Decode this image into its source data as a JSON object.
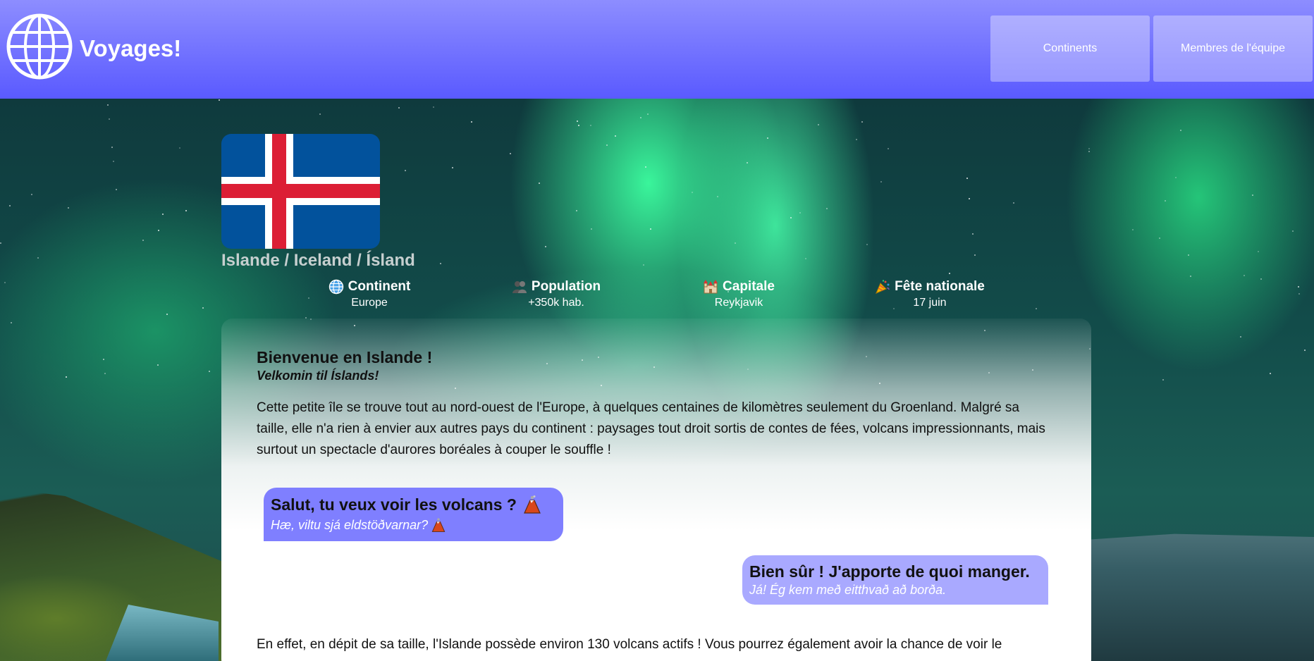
{
  "header": {
    "brand": "Voyages!",
    "logo_icon": "globe-icon",
    "nav": [
      {
        "label": "Continents"
      },
      {
        "label": "Membres de l'équipe"
      }
    ]
  },
  "country": {
    "flag_icon": "iceland-flag",
    "name": "Islande / Iceland / Ísland",
    "facts": [
      {
        "icon": "globe-icon",
        "title": "Continent",
        "value": "Europe"
      },
      {
        "icon": "people-icon",
        "title": "Population",
        "value": "+350k hab."
      },
      {
        "icon": "castle-icon",
        "title": "Capitale",
        "value": "Reykjavik"
      },
      {
        "icon": "party-popper-icon",
        "title": "Fête nationale",
        "value": "17 juin"
      }
    ]
  },
  "article": {
    "title": "Bienvenue en Islande !",
    "subtitle": "Velkomin til Íslands!",
    "intro": "Cette petite île se trouve tout au nord-ouest de l'Europe, à quelques centaines de kilomètres seulement du Groenland. Malgré sa taille, elle n'a rien à envier aux autres pays du continent : paysages tout droit sortis de contes de fées, volcans impressionnants, mais surtout un spectacle d'aurores boréales à couper le souffle !",
    "dialogue": [
      {
        "text": "Salut, tu veux voir les volcans ?",
        "translation": "Hæ, viltu sjá eldstöðvarnar?",
        "icon": "volcano-icon"
      },
      {
        "text": "Bien sûr ! J'apporte de quoi manger.",
        "translation": "Já! Ég kem með eitthvað að borða."
      }
    ],
    "outro": "En effet, en dépit de sa taille, l'Islande possède environ 130 volcans actifs ! Vous pourrez également avoir la chance de voir le"
  },
  "colors": {
    "header_top": "#8d8dff",
    "header_bottom": "#5a5aff",
    "bubble_left": "#7f7fff",
    "bubble_right": "#a9a9ff",
    "flag_blue": "#02529c",
    "flag_red": "#dc1e35"
  }
}
